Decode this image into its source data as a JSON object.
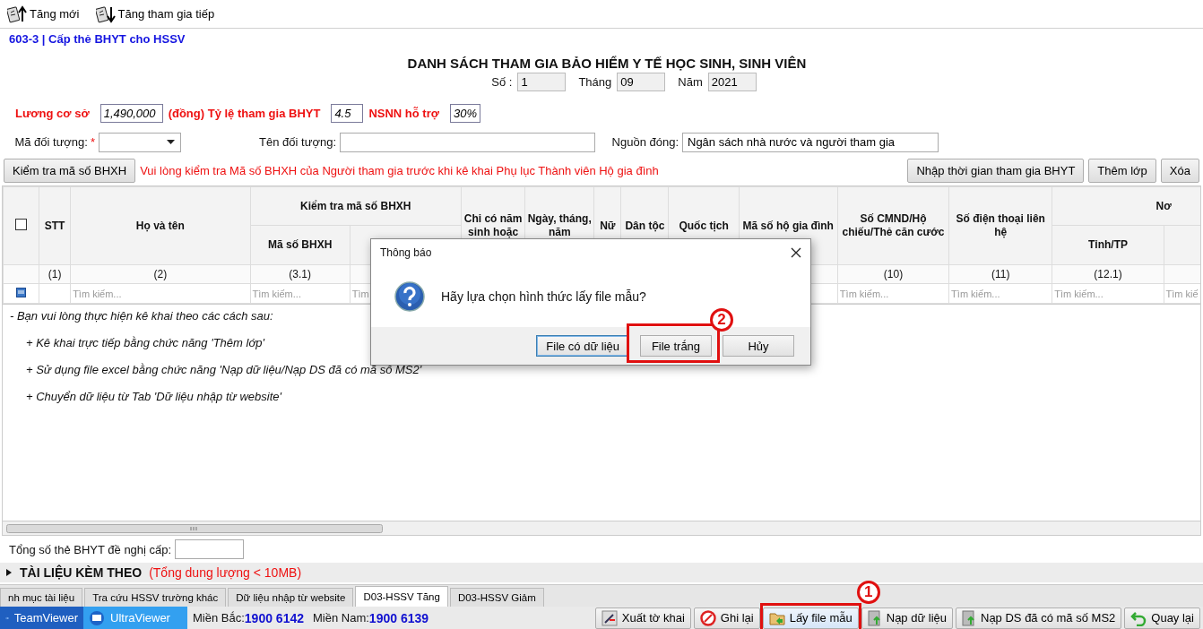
{
  "toolbar": [
    {
      "label": "Tăng mới"
    },
    {
      "label": "Tăng tham gia tiếp"
    }
  ],
  "form_code": "603-3 | Cấp thẻ BHYT cho HSSV",
  "title": "DANH SÁCH THAM GIA BẢO HIỂM Y TẾ HỌC SINH, SINH VIÊN",
  "period": [
    {
      "label": "Số :",
      "value": "1"
    },
    {
      "label": "Tháng",
      "value": "09"
    },
    {
      "label": "Năm",
      "value": "2021"
    }
  ],
  "rates": [
    {
      "label": "Lương cơ sở",
      "value": "1,490,000"
    },
    {
      "label": "(đồng) Tỷ lệ tham gia BHYT",
      "value": "4.5"
    },
    {
      "label": "NSNN hỗ trợ",
      "value": "30%"
    }
  ],
  "subject": {
    "code_label": "Mã đối tượng:",
    "required_mark": "*",
    "name_label": "Tên đối tượng:",
    "source_label": "Nguồn đóng:",
    "source_value": "Ngân sách nhà nước và người tham gia"
  },
  "check_button": "Kiểm tra mã số BHXH",
  "warning": "Vui lòng kiểm tra Mã số BHXH của Người tham gia trước khi kê khai Phụ lục Thành viên Hộ gia đình",
  "action_buttons": [
    "Nhập thời gian tham gia BHYT",
    "Thêm lớp",
    "Xóa"
  ],
  "table": {
    "select_all_checked": false,
    "columns": [
      {
        "header": "STT",
        "number": "(1)"
      },
      {
        "header": "Họ và tên",
        "number": "(2)",
        "search": "Tìm kiếm..."
      },
      {
        "group": "Kiểm tra mã số BHXH",
        "children": [
          {
            "header": "Mã số BHXH",
            "number": "(3.1)",
            "search": "Tìm kiếm..."
          },
          {
            "search": "Tìm"
          }
        ]
      },
      {
        "header": "Chi có năm sinh hoặc"
      },
      {
        "header": "Ngày, tháng, năm"
      },
      {
        "header": "Nữ"
      },
      {
        "header": "Dân tộc"
      },
      {
        "header": "Quốc tịch"
      },
      {
        "header": "Mã số hộ gia đình"
      },
      {
        "header": "Số CMND/Hộ chiếu/Thẻ căn cước",
        "number": "(10)",
        "search": "Tìm kiếm..."
      },
      {
        "header": "Số điện thoại liên hệ",
        "number": "(11)",
        "search": "Tìm kiếm..."
      },
      {
        "group": "Nơ",
        "children": [
          {
            "header": "Tỉnh/TP",
            "number": "(12.1)",
            "search": "Tìm kiếm..."
          },
          {
            "search": "Tìm kiế"
          }
        ]
      }
    ]
  },
  "instructions": [
    "- Bạn vui lòng thực hiện kê khai theo các cách sau:",
    "+ Kê khai trực tiếp bằng chức năng 'Thêm lớp'",
    "+ Sử dụng file excel bằng chức năng 'Nạp dữ liệu/Nạp DS đã có mã số MS2'",
    "+ Chuyển dữ liệu từ Tab 'Dữ liệu nhập từ website'"
  ],
  "total": {
    "label": "Tổng số thẻ BHYT đề nghị cấp:"
  },
  "attachments": {
    "title": "TÀI LIỆU KÈM THEO",
    "note": "(Tổng dung lượng < 10MB)",
    "expanded": false
  },
  "tabs": [
    {
      "label": "nh mục tài liệu",
      "selected": false
    },
    {
      "label": "Tra cứu HSSV trường khác",
      "selected": false
    },
    {
      "label": "Dữ liệu nhập từ website",
      "selected": false
    },
    {
      "label": "D03-HSSV Tăng",
      "selected": true
    },
    {
      "label": "D03-HSSV Giảm",
      "selected": false
    }
  ],
  "remote": [
    {
      "label": "TeamViewer"
    },
    {
      "label": "UltraViewer"
    }
  ],
  "hotlines": [
    {
      "label": "Miền Bắc:",
      "number": "1900 6142"
    },
    {
      "label": "Miền Nam:",
      "number": "1900 6139"
    }
  ],
  "bottom_buttons": [
    {
      "label": "Xuất tờ khai"
    },
    {
      "label": "Ghi lại"
    },
    {
      "label": "Lấy file mẫu",
      "callout": "1"
    },
    {
      "label": "Nạp dữ liệu"
    },
    {
      "label": "Nạp DS đã có mã số MS2"
    },
    {
      "label": "Quay lại"
    }
  ],
  "dialog": {
    "title": "Thông báo",
    "message": "Hãy lựa chọn hình thức lấy file mẫu?",
    "buttons": [
      {
        "label": "File có dữ liệu",
        "selected": true
      },
      {
        "label": "File trắng",
        "selected": false,
        "callout": "2"
      },
      {
        "label": "Hủy",
        "selected": false
      }
    ]
  }
}
